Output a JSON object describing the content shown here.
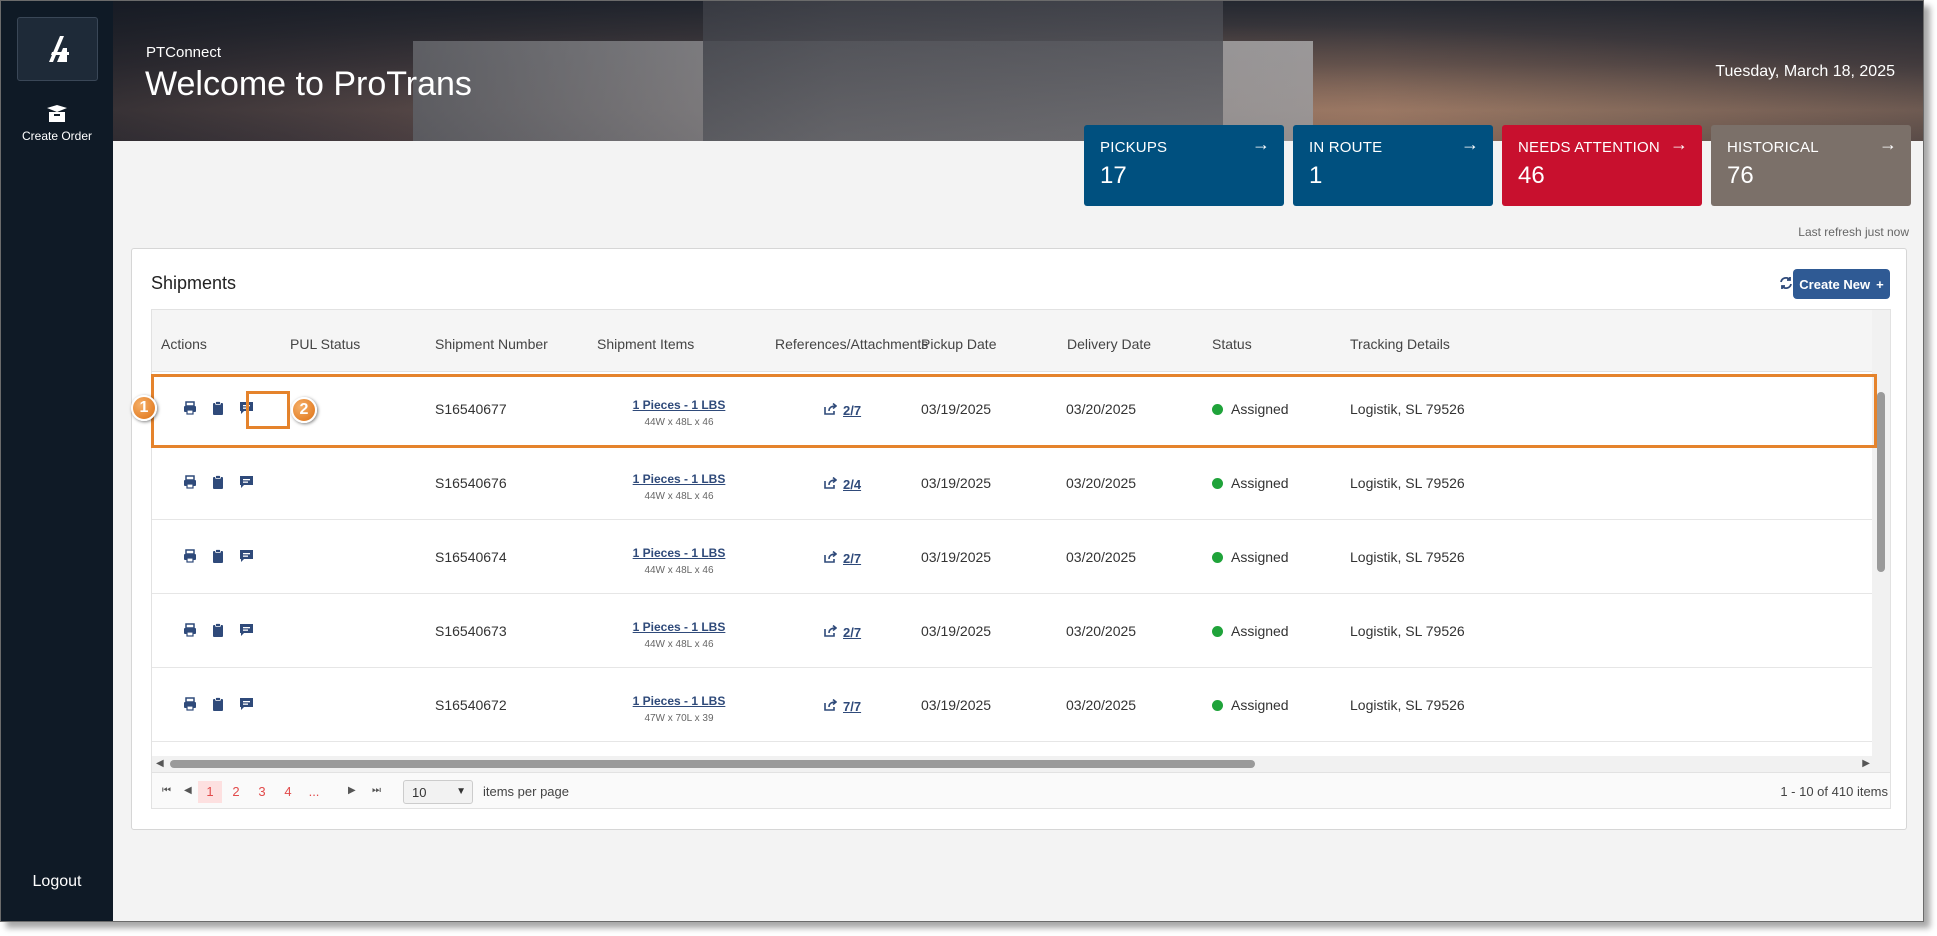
{
  "sidebar": {
    "logo_icon": "protrans-logo-icon",
    "create_order_label": "Create Order",
    "logout_label": "Logout"
  },
  "hero": {
    "subtitle": "PTConnect",
    "title": "Welcome to ProTrans",
    "date": "Tuesday, March 18, 2025"
  },
  "tiles": [
    {
      "label": "PICKUPS",
      "count": "17",
      "color": "#00507f"
    },
    {
      "label": "IN ROUTE",
      "count": "1",
      "color": "#00507f"
    },
    {
      "label": "NEEDS ATTENTION",
      "count": "46",
      "color": "#c8102e"
    },
    {
      "label": "HISTORICAL",
      "count": "76",
      "color": "#7b7069"
    }
  ],
  "last_refresh": "Last refresh just now",
  "shipments": {
    "title": "Shipments",
    "create_new_label": "Create New",
    "columns": [
      "Actions",
      "PUL Status",
      "Shipment Number",
      "Shipment Items",
      "References/Attachments",
      "Pickup Date",
      "Delivery Date",
      "Status",
      "Tracking Details"
    ],
    "rows": [
      {
        "number": "S16540677",
        "items": "1 Pieces - 1 LBS",
        "dims": "44W x 48L x 46",
        "refs": "2/7",
        "pickup": "03/19/2025",
        "delivery": "03/20/2025",
        "status": "Assigned",
        "tracking": "Logistik, SL 79526"
      },
      {
        "number": "S16540676",
        "items": "1 Pieces - 1 LBS",
        "dims": "44W x 48L x 46",
        "refs": "2/4",
        "pickup": "03/19/2025",
        "delivery": "03/20/2025",
        "status": "Assigned",
        "tracking": "Logistik, SL 79526"
      },
      {
        "number": "S16540674",
        "items": "1 Pieces - 1 LBS",
        "dims": "44W x 48L x 46",
        "refs": "2/7",
        "pickup": "03/19/2025",
        "delivery": "03/20/2025",
        "status": "Assigned",
        "tracking": "Logistik, SL 79526"
      },
      {
        "number": "S16540673",
        "items": "1 Pieces - 1 LBS",
        "dims": "44W x 48L x 46",
        "refs": "2/7",
        "pickup": "03/19/2025",
        "delivery": "03/20/2025",
        "status": "Assigned",
        "tracking": "Logistik, SL 79526"
      },
      {
        "number": "S16540672",
        "items": "1 Pieces - 1 LBS",
        "dims": "47W x 70L x 39",
        "refs": "7/7",
        "pickup": "03/19/2025",
        "delivery": "03/20/2025",
        "status": "Assigned",
        "tracking": "Logistik, SL 79526"
      }
    ]
  },
  "pager": {
    "pages": [
      "1",
      "2",
      "3",
      "4",
      "..."
    ],
    "page_size": "10",
    "items_per_page_label": "items per page",
    "info": "1 - 10 of 410 items"
  },
  "callouts": [
    "1",
    "2"
  ],
  "colors": {
    "status_assigned": "#1fa33a",
    "highlight": "#e5832c",
    "accent": "#2f5a94"
  }
}
